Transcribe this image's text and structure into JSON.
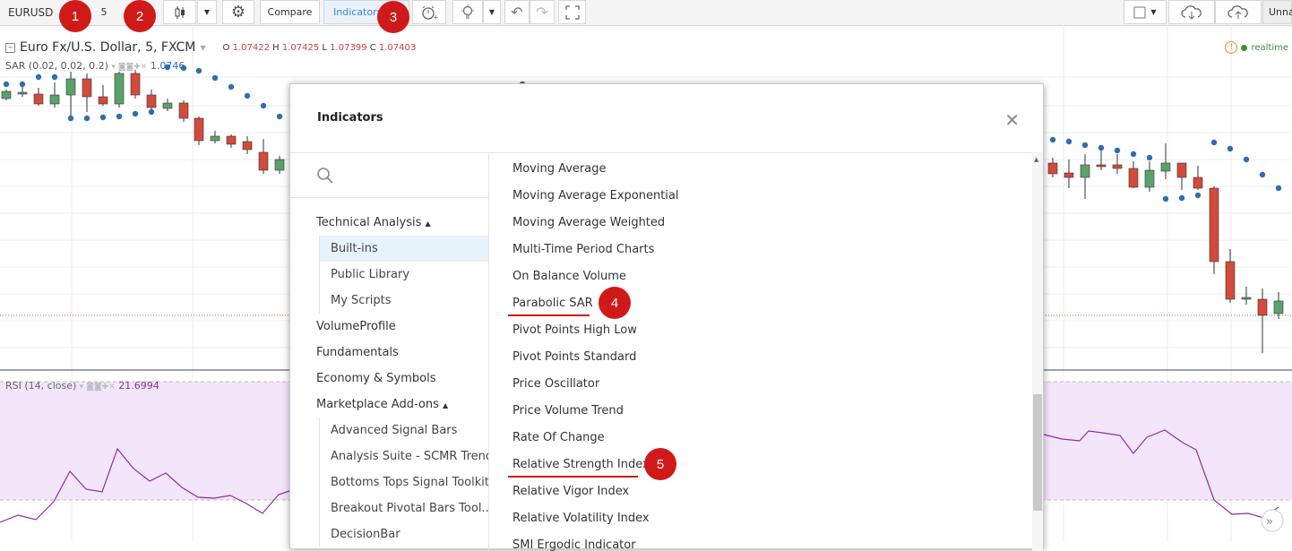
{
  "toolbar": {
    "symbol": "EURUSD",
    "interval": "5",
    "compare_label": "Compare",
    "indicators_label": "Indicators",
    "layout_name": "Unna"
  },
  "markers": [
    "1",
    "2",
    "3",
    "4",
    "5"
  ],
  "chart": {
    "title": "Euro Fx/U.S. Dollar, 5, FXCM",
    "open_label": "O",
    "open": "1.07422",
    "high_label": "H",
    "high": "1.07425",
    "low_label": "L",
    "low": "1.07399",
    "close_label": "C",
    "close": "1.07403",
    "sar_label": "SAR (0.02, 0.02, 0.2)",
    "sar_value": "1.0746",
    "rsi_label": "RSI (14, close)",
    "rsi_value": "21.6994",
    "realtime": "realtime"
  },
  "modal": {
    "title": "Indicators",
    "categories": {
      "technical": "Technical Analysis",
      "builtins": "Built-ins",
      "public_library": "Public Library",
      "my_scripts": "My Scripts",
      "volume_profile": "VolumeProfile",
      "fundamentals": "Fundamentals",
      "economy": "Economy & Symbols",
      "marketplace": "Marketplace Add-ons",
      "addons": [
        "Advanced Signal Bars",
        "Analysis Suite - SCMR Trends",
        "Bottoms Tops Signal Toolkit",
        "Breakout Pivotal Bars Tool...",
        "DecisionBar"
      ]
    },
    "indicators": [
      "Moving Average",
      "Moving Average Exponential",
      "Moving Average Weighted",
      "Multi-Time Period Charts",
      "On Balance Volume",
      "Parabolic SAR",
      "Pivot Points High Low",
      "Pivot Points Standard",
      "Price Oscillator",
      "Price Volume Trend",
      "Rate Of Change",
      "Relative Strength Index",
      "Relative Vigor Index",
      "Relative Volatility Index",
      "SMI Ergodic Indicator"
    ]
  },
  "colors": {
    "up": "#5aa16e",
    "down": "#d24b3b",
    "sar": "#2f6db4",
    "rsi": "#8e2ca4",
    "rsi_band": "#f3e6fb",
    "marker": "#d01a1a"
  }
}
